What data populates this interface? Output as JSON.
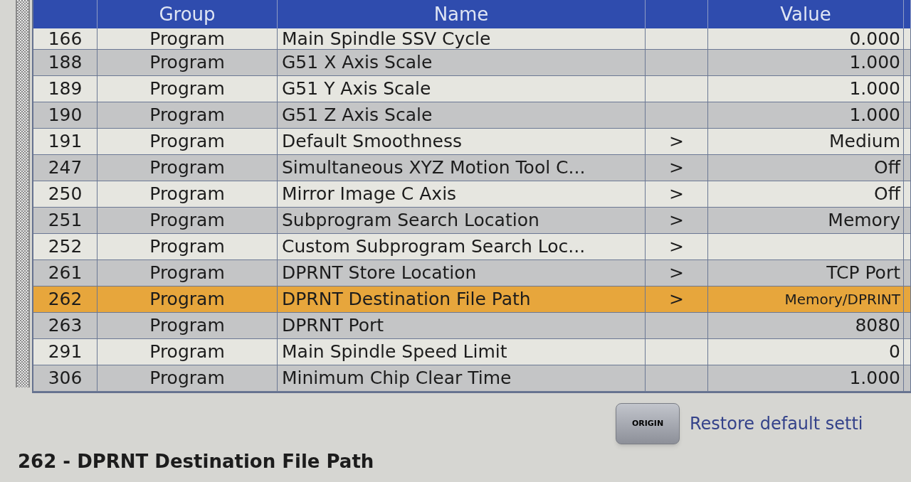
{
  "table": {
    "columns": [
      "Group",
      "Name",
      "Value"
    ],
    "rows": [
      {
        "number": "166",
        "group": "Program",
        "name": "Main Spindle SSV Cycle",
        "value": "0.000",
        "selected": false
      },
      {
        "number": "188",
        "group": "Program",
        "name": "G51 X Axis Scale",
        "value": "1.000",
        "selected": false
      },
      {
        "number": "189",
        "group": "Program",
        "name": "G51 Y Axis Scale",
        "value": "1.000",
        "selected": false
      },
      {
        "number": "190",
        "group": "Program",
        "name": "G51 Z Axis Scale",
        "value": "1.000",
        "selected": false
      },
      {
        "number": "191",
        "group": "Program",
        "name": "Default Smoothness",
        "submenu": ">",
        "value": "Medium",
        "selected": false
      },
      {
        "number": "247",
        "group": "Program",
        "name": "Simultaneous XYZ Motion Tool C...",
        "submenu": ">",
        "value": "Off",
        "selected": false
      },
      {
        "number": "250",
        "group": "Program",
        "name": "Mirror Image C Axis",
        "submenu": ">",
        "value": "Off",
        "selected": false
      },
      {
        "number": "251",
        "group": "Program",
        "name": "Subprogram Search Location",
        "submenu": ">",
        "value": "Memory",
        "selected": false
      },
      {
        "number": "252",
        "group": "Program",
        "name": "Custom Subprogram Search Loc...",
        "submenu": ">",
        "selected": false
      },
      {
        "number": "261",
        "group": "Program",
        "name": "DPRNT Store Location",
        "submenu": ">",
        "value": "TCP Port",
        "selected": false
      },
      {
        "number": "262",
        "group": "Program",
        "name": "DPRNT Destination File Path",
        "submenu": ">",
        "value": "Memory/DPRINT",
        "selected": true
      },
      {
        "number": "263",
        "group": "Program",
        "name": "DPRNT Port",
        "value": "8080",
        "selected": false
      },
      {
        "number": "291",
        "group": "Program",
        "name": "Main Spindle Speed Limit",
        "value": "0",
        "selected": false
      },
      {
        "number": "306",
        "group": "Program",
        "name": "Minimum Chip Clear Time",
        "value": "1.000",
        "selected": false
      }
    ]
  },
  "footer": {
    "key": "ORIGIN",
    "hint": "Restore default setti"
  },
  "description": {
    "title": "262 - DPRNT Destination File Path"
  }
}
